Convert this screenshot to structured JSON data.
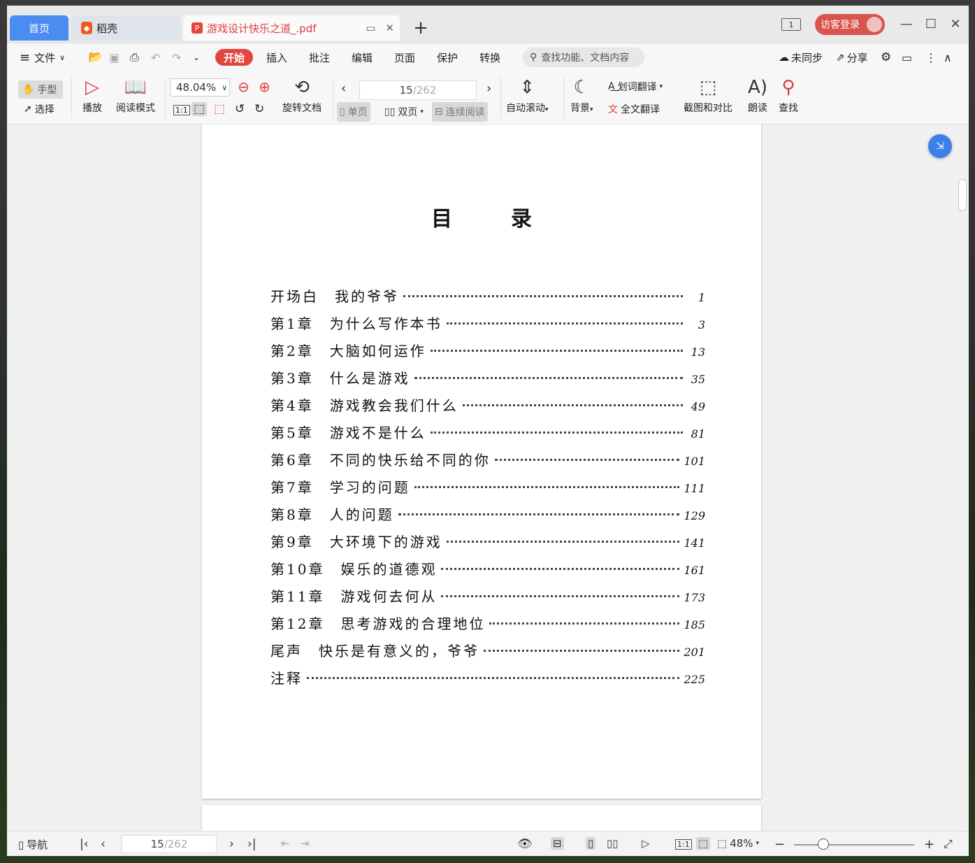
{
  "tabs": {
    "home": "首页",
    "daoke": "稻壳",
    "pdf": "游戏设计快乐之道_.pdf",
    "new_tab": "+"
  },
  "titlebar": {
    "page_badge": "1",
    "login": "访客登录"
  },
  "menu": {
    "file": "文件",
    "items": [
      "开始",
      "插入",
      "批注",
      "编辑",
      "页面",
      "保护",
      "转换"
    ],
    "search_placeholder": "查找功能、文档内容",
    "sync": "未同步",
    "share": "分享"
  },
  "ribbon": {
    "hand": "手型",
    "select": "选择",
    "play": "播放",
    "read_mode": "阅读模式",
    "zoom": "48.04%",
    "rotate": "旋转文档",
    "page_current": "15",
    "page_total": "/262",
    "single": "单页",
    "double": "双页",
    "continuous": "连续阅读",
    "auto_scroll": "自动滚动",
    "background": "背景",
    "word_translate": "划词翻译",
    "full_translate": "全文翻译",
    "screenshot_compare": "截图和对比",
    "read_aloud": "朗读",
    "find": "查找"
  },
  "document": {
    "toc_title": "目录",
    "toc": [
      {
        "label": "开场白　我的爷爷",
        "page": "1"
      },
      {
        "label": "第1章　为什么写作本书",
        "page": "3"
      },
      {
        "label": "第2章　大脑如何运作",
        "page": "13"
      },
      {
        "label": "第3章　什么是游戏",
        "page": "35"
      },
      {
        "label": "第4章　游戏教会我们什么",
        "page": "49"
      },
      {
        "label": "第5章　游戏不是什么",
        "page": "81"
      },
      {
        "label": "第6章　不同的快乐给不同的你",
        "page": "101"
      },
      {
        "label": "第7章　学习的问题",
        "page": "111"
      },
      {
        "label": "第8章　人的问题",
        "page": "129"
      },
      {
        "label": "第9章　大环境下的游戏",
        "page": "141"
      },
      {
        "label": "第10章　娱乐的道德观",
        "page": "161"
      },
      {
        "label": "第11章　游戏何去何从",
        "page": "173"
      },
      {
        "label": "第12章　思考游戏的合理地位",
        "page": "185"
      },
      {
        "label": "尾声　快乐是有意义的，爷爷",
        "page": "201"
      },
      {
        "label": "注释",
        "page": "225"
      }
    ]
  },
  "statusbar": {
    "nav": "导航",
    "page_current": "15",
    "page_total": "/262",
    "zoom": "48%"
  },
  "colors": {
    "accent_red": "#e3463e",
    "tab_blue": "#4a8cf0",
    "float_blue": "#3b80e8"
  }
}
